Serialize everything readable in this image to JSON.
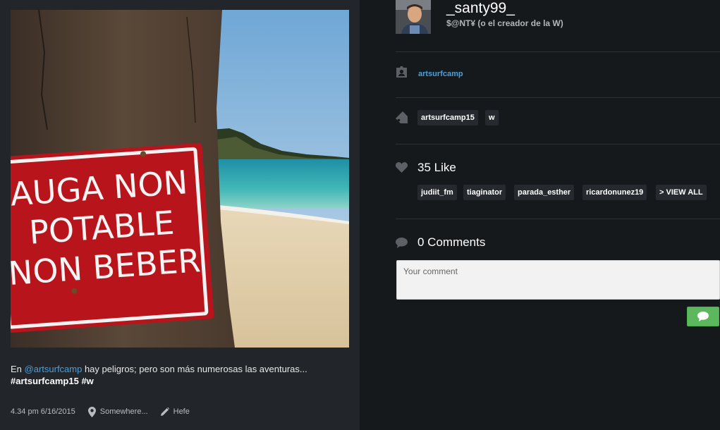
{
  "post": {
    "photo_sign": {
      "line1": "AUGA NON",
      "line2": "POTABLE",
      "line3": "NON BEBER"
    },
    "caption": {
      "prefix": "En ",
      "mention": "@artsurfcamp",
      "text": " hay peligros; pero son más numerosas las aventuras...",
      "hashtags": "#artsurfcamp15 #w"
    },
    "meta": {
      "timestamp": "4.34 pm 6/16/2015",
      "location": "Somewhere...",
      "filter": "Hefe"
    }
  },
  "profile": {
    "username": "_santy99_",
    "bio": "$@NT¥ (o el creador de la W)"
  },
  "tagged_user": "artsurfcamp",
  "tags": [
    "artsurfcamp15",
    "w"
  ],
  "likes": {
    "label": "35 Like",
    "users": [
      "judiit_fm",
      "tiaginator",
      "parada_esther",
      "ricardonunez19"
    ],
    "view_all": "> VIEW ALL"
  },
  "comments": {
    "label": "0 Comments",
    "placeholder": "Your comment"
  },
  "colors": {
    "link": "#4a9fdc",
    "send_button": "#5cb85c",
    "sign_red": "#b8141c"
  }
}
